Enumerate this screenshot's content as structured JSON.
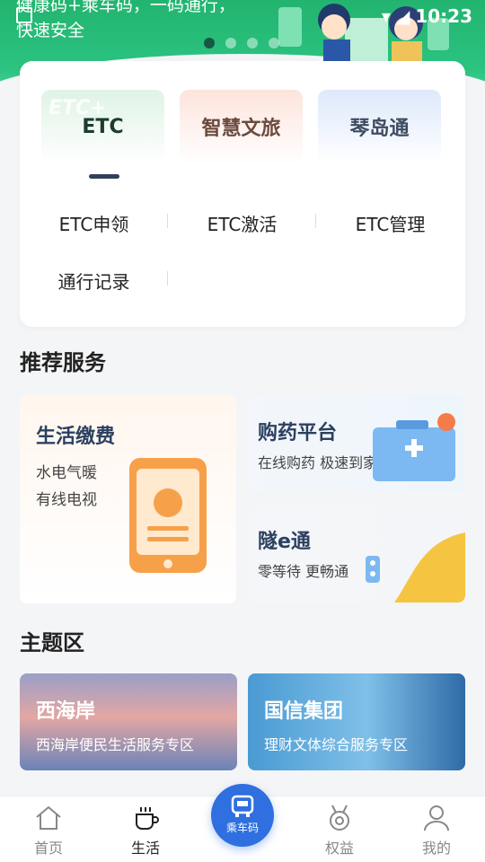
{
  "banner": {
    "text_line1": "健康码+乘车码，一码通行，",
    "text_line2": "快速安全",
    "dots": 4,
    "active_dot": 0
  },
  "status": {
    "time": "10:23"
  },
  "service_tabs": [
    {
      "label": "ETC",
      "watermark": "ETC+"
    },
    {
      "label": "智慧文旅"
    },
    {
      "label": "琴岛通"
    }
  ],
  "etc_items": [
    "ETC申领",
    "ETC激活",
    "ETC管理",
    "通行记录"
  ],
  "recommended": {
    "title": "推荐服务",
    "big": {
      "title": "生活缴费",
      "line1": "水电气暖",
      "line2": "有线电视"
    },
    "pharmacy": {
      "title": "购药平台",
      "sub": "在线购药 极速到家"
    },
    "tunnel": {
      "title": "隧e通",
      "sub": "零等待 更畅通"
    }
  },
  "theme": {
    "title": "主题区",
    "cards": [
      {
        "title": "西海岸",
        "sub": "西海岸便民生活服务专区"
      },
      {
        "title": "国信集团",
        "sub": "理财文体综合服务专区"
      }
    ]
  },
  "nav": {
    "items": [
      "首页",
      "生活",
      "权益",
      "我的"
    ],
    "center_label": "乘车码",
    "active": "生活"
  },
  "colors": {
    "brand_green": "#2cc381",
    "nav_blue": "#2f6fe0"
  }
}
